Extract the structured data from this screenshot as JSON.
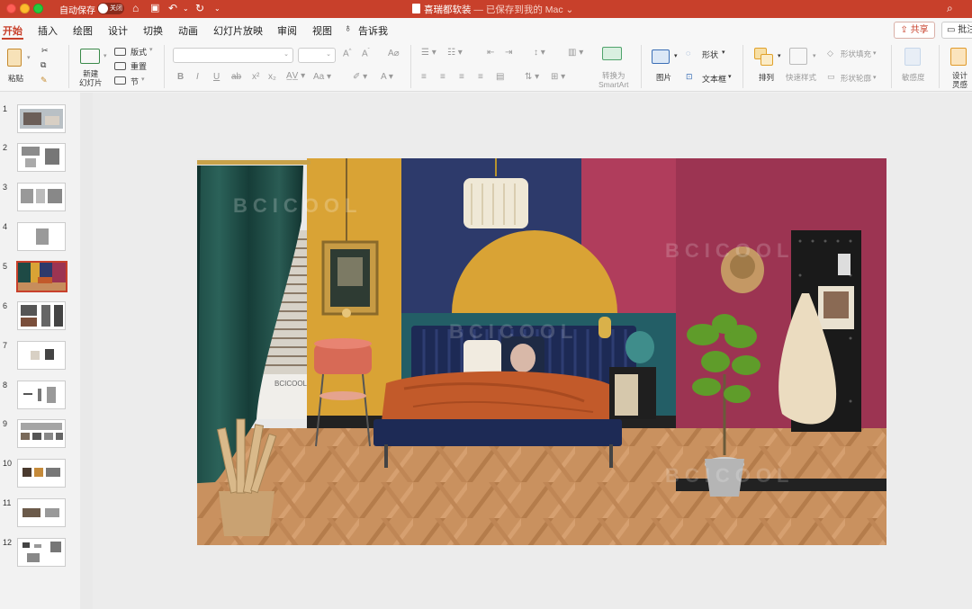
{
  "titlebar": {
    "autosave_label": "自动保存",
    "toggle_label": "关闭",
    "doc_name": "喜瑞都软装",
    "doc_status": "— 已保存到我的 Mac"
  },
  "tabs": [
    {
      "label": "开始"
    },
    {
      "label": "插入"
    },
    {
      "label": "绘图"
    },
    {
      "label": "设计"
    },
    {
      "label": "切换"
    },
    {
      "label": "动画"
    },
    {
      "label": "幻灯片放映"
    },
    {
      "label": "审阅"
    },
    {
      "label": "视图"
    },
    {
      "label": "告诉我"
    }
  ],
  "share": {
    "label": "共享"
  },
  "comment": {
    "label": "批注"
  },
  "toolbar": {
    "paste_label": "粘贴",
    "new_slide_label": "新建\n幻灯片",
    "layout_label": "版式",
    "reset_label": "重置",
    "section_label": "节",
    "convert_smartart": "转换为\nSmartArt",
    "picture_label": "图片",
    "shape_label": "形状",
    "textbox_label": "文本框",
    "arrange_label": "排列",
    "quick_style_label": "快速样式",
    "shape_fill_label": "形状填充",
    "shape_outline_label": "形状轮廓",
    "sensitivity_label": "敏感度",
    "design_ideas_label": "设计\n灵感"
  },
  "slides": [
    {
      "num": "1"
    },
    {
      "num": "2"
    },
    {
      "num": "3"
    },
    {
      "num": "4"
    },
    {
      "num": "5"
    },
    {
      "num": "6"
    },
    {
      "num": "7"
    },
    {
      "num": "8"
    },
    {
      "num": "9"
    },
    {
      "num": "10"
    },
    {
      "num": "11"
    },
    {
      "num": "12"
    }
  ],
  "selected_slide": "5",
  "slide_content": {
    "bcicool_text": "BCICOOL",
    "watermark": "BCICOOL"
  },
  "colors": {
    "accent": "#c8402b",
    "mustard": "#d9a335",
    "navy": "#2d3a6b",
    "magenta": "#9c3452",
    "teal": "#235e66",
    "rust": "#c25a2a",
    "curtain": "#1e4a45"
  }
}
